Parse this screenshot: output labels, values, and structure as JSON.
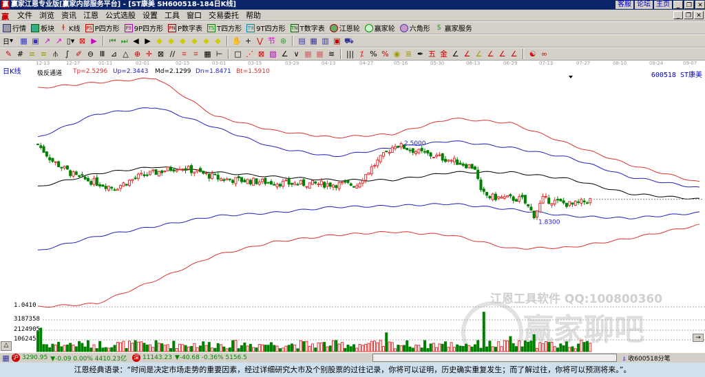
{
  "title": {
    "text": "赢家江恩专业版[赢家内部服务平台] - [ST康美   SH600518-184日K线]",
    "logo": "赢",
    "links": [
      "客服",
      "论坛",
      "主页"
    ]
  },
  "menu": [
    "文件",
    "浏览",
    "资讯",
    "江恩",
    "公式选股",
    "设置",
    "工具",
    "窗口",
    "交易委托",
    "帮助"
  ],
  "toolbar1": [
    {
      "icon": "PS",
      "label": "P四方形"
    },
    {
      "icon": "P9",
      "label": "9P四方形"
    },
    {
      "icon": "PN",
      "label": "P数字表"
    },
    {
      "icon": "TS",
      "label": "T四方形"
    },
    {
      "icon": "T9",
      "label": "9T四方形"
    },
    {
      "icon": "TN",
      "label": "T数字表"
    }
  ],
  "toolbar1_extra": {
    "quotes": "行情",
    "sector": "板块",
    "kline": "K线",
    "wheel": "江恩轮",
    "winwheel": "赢家轮",
    "hexagon": "六角形",
    "service": "赢家服务"
  },
  "toolbar2": {
    "period": "日"
  },
  "chart": {
    "period_label": "日K线",
    "indicator": {
      "name": "极反通道",
      "tp": "Tp=2.5296",
      "up": "Up=2.3443",
      "md": "Md=2.1299",
      "dn": "Dn=1.8471",
      "bt": "Bt=1.5910"
    },
    "stock": "600518  ST康美",
    "dates": [
      "12-13",
      "12-27",
      "01-11",
      "02-01",
      "02-15",
      "03-01",
      "03-15",
      "03-29",
      "04-13",
      "04-27",
      "05-16",
      "05-30",
      "06-13",
      "06-29",
      "07-13",
      "07-27",
      "08-10",
      "08-24",
      "09-07"
    ],
    "high_label": "2.5000",
    "low_label": "1.8300",
    "price_min_label": "1.0410",
    "volume_ticks": [
      "3187358",
      "2124905",
      "1062453"
    ],
    "watermark_text": "江恩工具软件  QQ:100800360",
    "watermark_logo": "赢家聊吧"
  },
  "chart_data": {
    "type": "candlestick",
    "price_range": [
      1.041,
      3.09
    ],
    "candle_count": 188,
    "close_keypoints": [
      [
        0,
        2.49
      ],
      [
        5,
        2.34
      ],
      [
        13,
        2.2
      ],
      [
        26,
        2.1
      ],
      [
        34,
        2.2
      ],
      [
        48,
        2.29
      ],
      [
        62,
        2.18
      ],
      [
        85,
        2.14
      ],
      [
        108,
        2.13
      ],
      [
        114,
        2.31
      ],
      [
        121,
        2.49
      ],
      [
        129,
        2.42
      ],
      [
        141,
        2.34
      ],
      [
        148,
        2.28
      ],
      [
        150,
        2.06
      ],
      [
        153,
        2.02
      ],
      [
        164,
        2.0
      ],
      [
        168,
        1.86
      ],
      [
        171,
        2.0
      ],
      [
        181,
        1.95
      ],
      [
        188,
        2.0
      ]
    ],
    "channels": {
      "index": [
        0,
        20,
        40,
        60,
        80,
        100,
        120,
        140,
        160,
        180,
        200,
        224
      ],
      "Tp": [
        2.99,
        3.04,
        3.08,
        2.74,
        2.61,
        2.55,
        2.58,
        2.72,
        2.68,
        2.49,
        2.31,
        2.15
      ],
      "Up": [
        2.55,
        2.76,
        2.82,
        2.64,
        2.46,
        2.38,
        2.46,
        2.52,
        2.46,
        2.37,
        2.2,
        2.1
      ],
      "Md": [
        2.11,
        2.23,
        2.29,
        2.24,
        2.2,
        2.17,
        2.17,
        2.24,
        2.24,
        2.18,
        2.05,
        2.0
      ],
      "Dn": [
        1.54,
        1.67,
        1.76,
        1.85,
        1.88,
        1.93,
        1.94,
        1.96,
        1.91,
        1.85,
        1.83,
        1.88
      ],
      "Bt": [
        1.04,
        1.07,
        1.28,
        1.5,
        1.62,
        1.68,
        1.71,
        1.68,
        1.56,
        1.57,
        1.65,
        1.77
      ]
    },
    "volume_range": [
      0,
      3700000
    ],
    "volume_spikes": [
      [
        1,
        2500000
      ],
      [
        0,
        2150000
      ],
      [
        118,
        2000000
      ],
      [
        151,
        4200000
      ],
      [
        160,
        1600000
      ],
      [
        168,
        1800000
      ]
    ]
  },
  "status": {
    "sh": "3290.95",
    "sh_chg": "▼-0.09 0.00% 4410.23亿",
    "sz": "11143.23",
    "sz_chg": "▼-40.68 -0.36% 5156.5",
    "sh_icon": "沪",
    "sz_icon": "深",
    "right": "收600518分笔"
  },
  "quote": "江恩经典语录：“时间是决定市场走势的重要因素，经过详细研究大市及个别股票的过往记录，你将可以证明，历史确实重复发生；而了解过往，你将可以预测将来。”。",
  "colors": {
    "up": "#e03030",
    "down": "#008000",
    "tp": "#e03030",
    "up_line": "#2020c0",
    "md": "#000000"
  }
}
